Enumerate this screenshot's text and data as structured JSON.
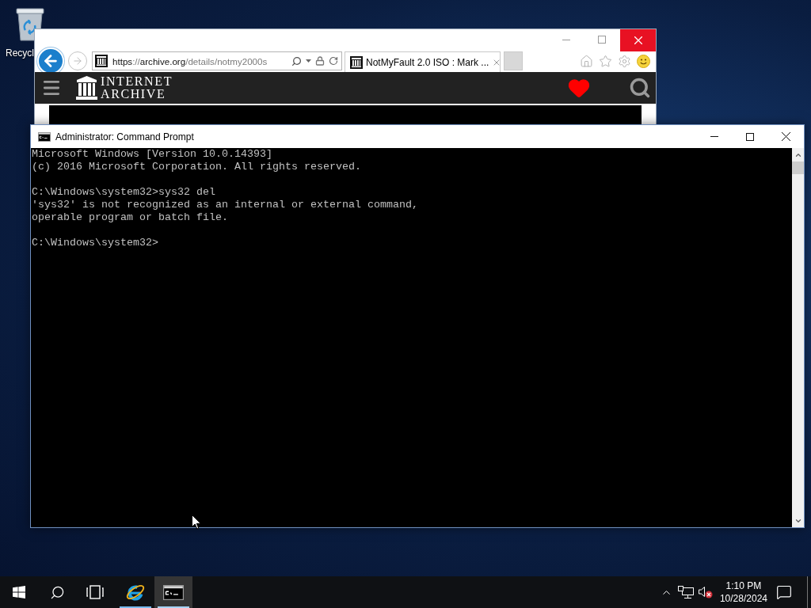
{
  "desktop": {
    "icons": [
      {
        "label": "Recycl"
      }
    ]
  },
  "browser": {
    "url_parts": [
      {
        "text": "https",
        "kind": "strong"
      },
      {
        "text": "://",
        "kind": "dim"
      },
      {
        "text": "archive.org",
        "kind": "strong"
      },
      {
        "text": "/details/notmy2000s",
        "kind": "dim"
      }
    ],
    "tabs": [
      {
        "title": "NotMyFault 2.0 ISO : Mark ...",
        "selected": true
      }
    ],
    "site": {
      "logo_lines": [
        "INTERNET",
        "ARCHIVE"
      ]
    }
  },
  "console": {
    "title": "Administrator: Command Prompt",
    "blocks": [
      [
        "Microsoft Windows [Version 10.0.14393]",
        "(c) 2016 Microsoft Corporation. All rights reserved."
      ],
      [
        "C:\\Windows\\system32>sys32 del",
        "'sys32' is not recognized as an internal or external command,",
        "operable program or batch file."
      ],
      [
        "C:\\Windows\\system32>"
      ]
    ]
  },
  "taskbar": {
    "apps": [
      {
        "kind": "browser",
        "running": true,
        "selected": false
      },
      {
        "kind": "console",
        "running": true,
        "selected": true
      }
    ],
    "clock": {
      "time": "1:10 PM",
      "date": "10/28/2024"
    }
  }
}
